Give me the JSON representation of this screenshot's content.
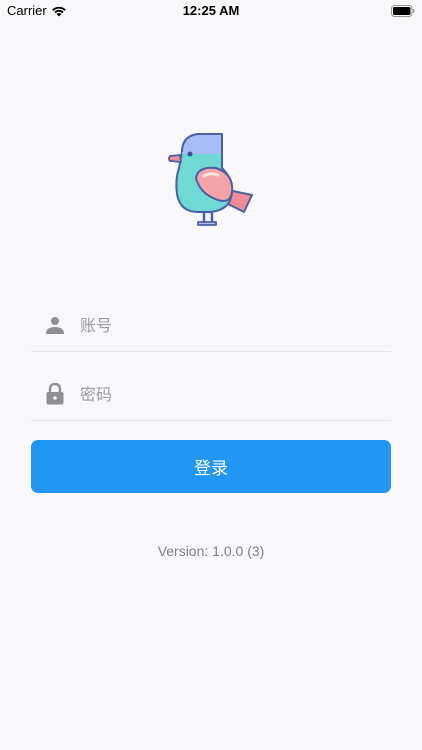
{
  "status_bar": {
    "carrier": "Carrier",
    "time": "12:25 AM",
    "icons": [
      "wifi-icon",
      "battery-icon"
    ]
  },
  "logo": {
    "icon": "bird-logo-icon"
  },
  "login_form": {
    "account_field": {
      "icon": "person-icon",
      "placeholder": "账号",
      "value": ""
    },
    "password_field": {
      "icon": "lock-icon",
      "placeholder": "密码",
      "value": ""
    },
    "login_button_label": "登录"
  },
  "footer": {
    "version": "Version: 1.0.0 (3)"
  },
  "colors": {
    "background": "#f8f8fa",
    "primary_button": "#2196f3",
    "icon_gray": "#8e8e93",
    "divider": "#e4e4e6"
  }
}
